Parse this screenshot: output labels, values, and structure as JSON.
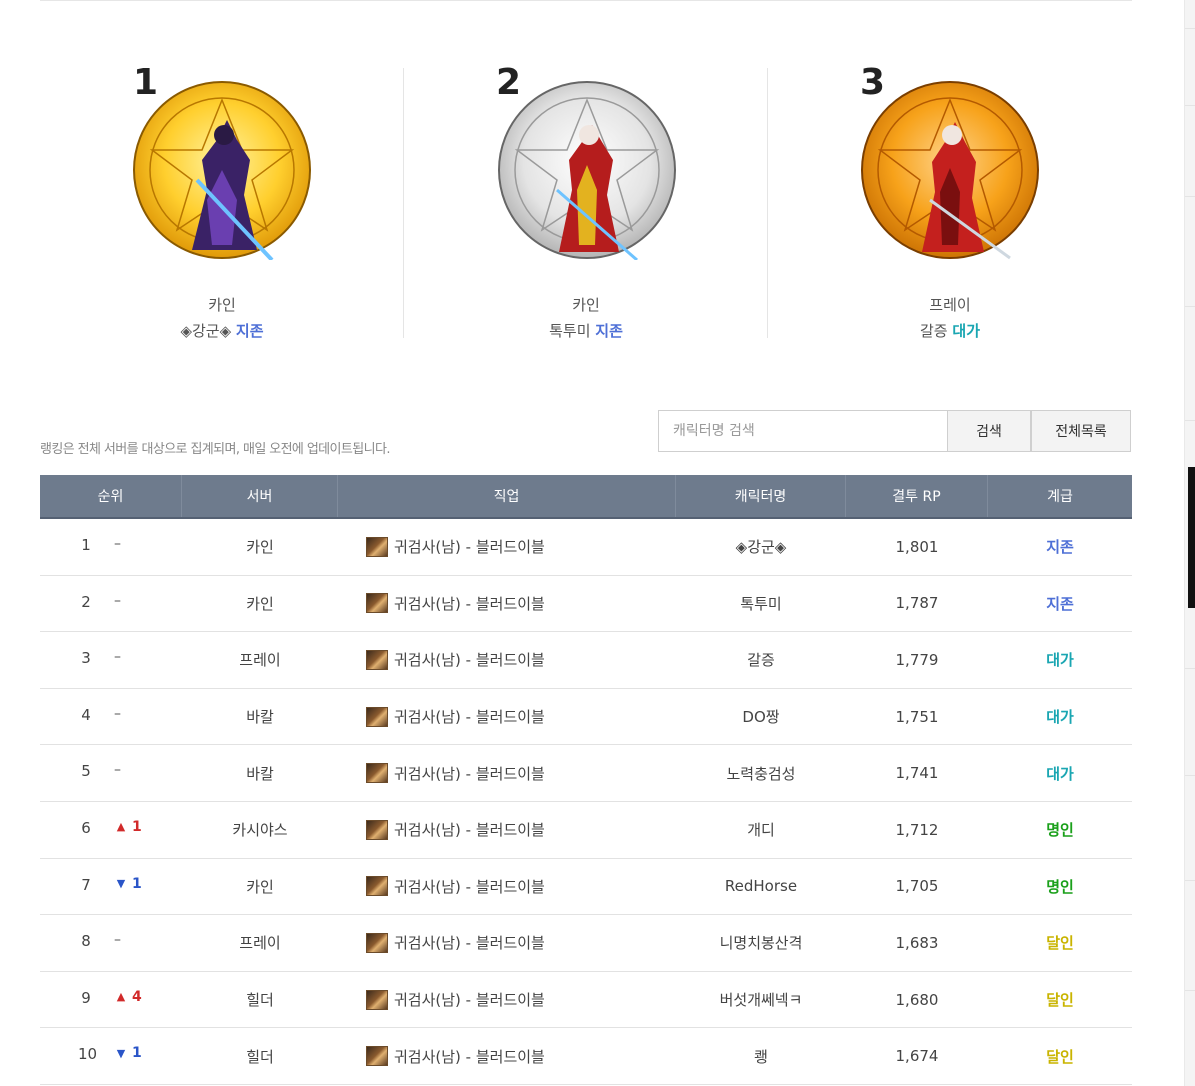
{
  "podium": [
    {
      "rank": "1",
      "server": "카인",
      "name": "◈강군◈",
      "grade": "지존",
      "grade_color": "#4e6fd6",
      "emblem": "gold"
    },
    {
      "rank": "2",
      "server": "카인",
      "name": "톡투미",
      "grade": "지존",
      "grade_color": "#4e6fd6",
      "emblem": "silver"
    },
    {
      "rank": "3",
      "server": "프레이",
      "name": "갈증",
      "grade": "대가",
      "grade_color": "#1aa6b2",
      "emblem": "bronze"
    }
  ],
  "notice": "랭킹은 전체 서버를 대상으로 집계되며, 매일 오전에 업데이트됩니다.",
  "search": {
    "placeholder": "캐릭터명 검색",
    "search_label": "검색",
    "all_label": "전체목록"
  },
  "table": {
    "headers": [
      "순위",
      "서버",
      "직업",
      "캐릭터명",
      "결투 RP",
      "계급"
    ],
    "rows": [
      {
        "rank": "1",
        "change": "–",
        "dir": "none",
        "server": "카인",
        "job": "귀검사(남) - 블러드이블",
        "name": "◈강군◈",
        "rp": "1,801",
        "grade": "지존",
        "grade_class": "g-jijon"
      },
      {
        "rank": "2",
        "change": "–",
        "dir": "none",
        "server": "카인",
        "job": "귀검사(남) - 블러드이블",
        "name": "톡투미",
        "rp": "1,787",
        "grade": "지존",
        "grade_class": "g-jijon"
      },
      {
        "rank": "3",
        "change": "–",
        "dir": "none",
        "server": "프레이",
        "job": "귀검사(남) - 블러드이블",
        "name": "갈증",
        "rp": "1,779",
        "grade": "대가",
        "grade_class": "g-daega"
      },
      {
        "rank": "4",
        "change": "–",
        "dir": "none",
        "server": "바칼",
        "job": "귀검사(남) - 블러드이블",
        "name": "DO짱",
        "rp": "1,751",
        "grade": "대가",
        "grade_class": "g-daega"
      },
      {
        "rank": "5",
        "change": "–",
        "dir": "none",
        "server": "바칼",
        "job": "귀검사(남) - 블러드이블",
        "name": "노력충검성",
        "rp": "1,741",
        "grade": "대가",
        "grade_class": "g-daega"
      },
      {
        "rank": "6",
        "change": "1",
        "dir": "up",
        "server": "카시야스",
        "job": "귀검사(남) - 블러드이블",
        "name": "개디",
        "rp": "1,712",
        "grade": "명인",
        "grade_class": "g-myeongin"
      },
      {
        "rank": "7",
        "change": "1",
        "dir": "down",
        "server": "카인",
        "job": "귀검사(남) - 블러드이블",
        "name": "RedHorse",
        "rp": "1,705",
        "grade": "명인",
        "grade_class": "g-myeongin"
      },
      {
        "rank": "8",
        "change": "–",
        "dir": "none",
        "server": "프레이",
        "job": "귀검사(남) - 블러드이블",
        "name": "니명치봉산격",
        "rp": "1,683",
        "grade": "달인",
        "grade_class": "g-dalin"
      },
      {
        "rank": "9",
        "change": "4",
        "dir": "up",
        "server": "힐더",
        "job": "귀검사(남) - 블러드이블",
        "name": "버섯개쎄넥ㅋ",
        "rp": "1,680",
        "grade": "달인",
        "grade_class": "g-dalin"
      },
      {
        "rank": "10",
        "change": "1",
        "dir": "down",
        "server": "힐더",
        "job": "귀검사(남) - 블러드이블",
        "name": "쾡",
        "rp": "1,674",
        "grade": "달인",
        "grade_class": "g-dalin"
      }
    ]
  },
  "icons": {
    "up": "▲",
    "down": "▼",
    "job_icon": "job-portrait-icon"
  }
}
